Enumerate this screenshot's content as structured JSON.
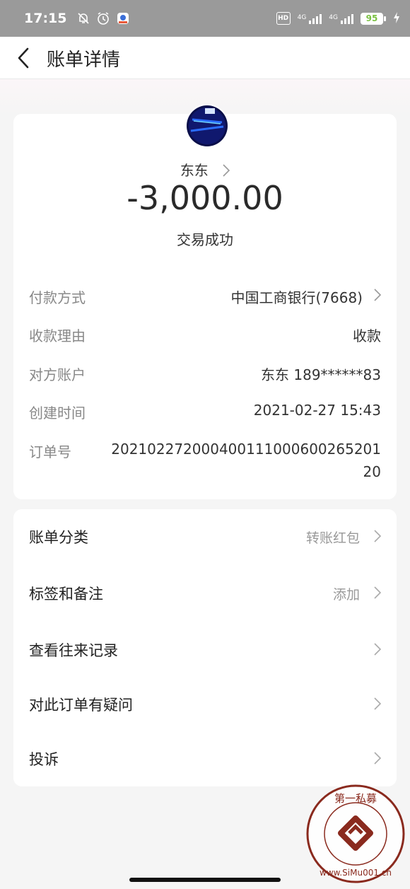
{
  "status_bar": {
    "time": "17:15",
    "hd": "HD",
    "sim1": "4G",
    "sim2": "4G",
    "battery": "95"
  },
  "nav": {
    "title": "账单详情"
  },
  "bill": {
    "payee": "东东",
    "amount": "-3,000.00",
    "status": "交易成功"
  },
  "details": [
    {
      "label": "付款方式",
      "value": "中国工商银行(7668)"
    },
    {
      "label": "收款理由",
      "value": "收款"
    },
    {
      "label": "对方账户",
      "value": "东东 189******83"
    },
    {
      "label": "创建时间",
      "value": "2021-02-27 15:43"
    },
    {
      "label": "订单号",
      "value": "20210227200040011100060026520120"
    }
  ],
  "actions": [
    {
      "label": "账单分类",
      "value": "转账红包"
    },
    {
      "label": "标签和备注",
      "value": "添加"
    },
    {
      "label": "查看往来记录",
      "value": ""
    },
    {
      "label": "对此订单有疑问",
      "value": ""
    },
    {
      "label": "投诉",
      "value": ""
    }
  ],
  "watermark": {
    "top_text": "第一私募",
    "bottom_text": "www.SiMu001.cn"
  },
  "colors": {
    "battery": "#7bc143",
    "background": "#f5f5f5",
    "card": "#ffffff"
  }
}
